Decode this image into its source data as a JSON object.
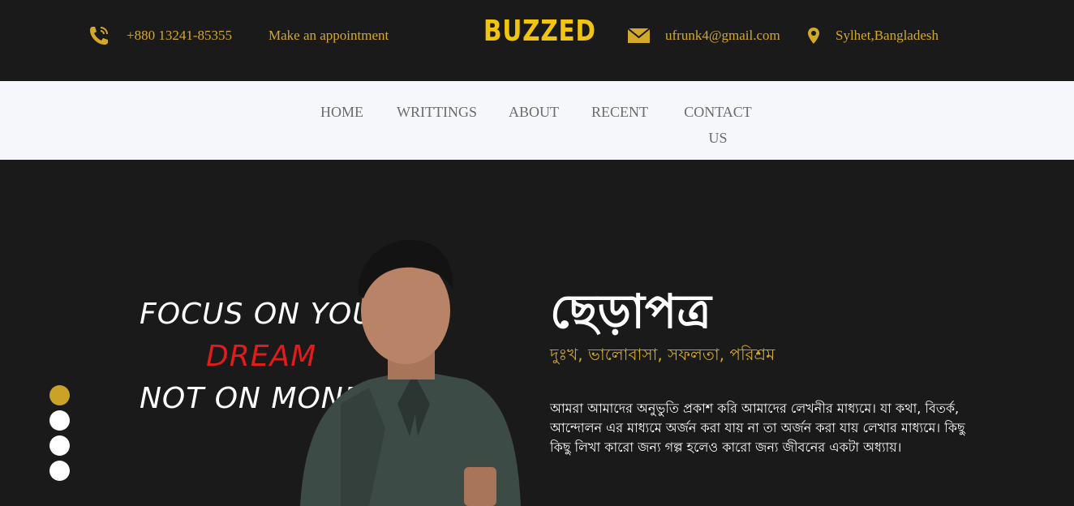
{
  "header": {
    "phone_icon": "phone-icon",
    "phone": "+880 13241-85355",
    "appointment": "Make an appointment",
    "brand": "BUZZED",
    "mail_icon": "mail-icon",
    "email": "ufrunk4@gmail.com",
    "location_icon": "location-pin-icon",
    "location": "Sylhet,Bangladesh"
  },
  "nav": {
    "items": [
      {
        "label": "HOME"
      },
      {
        "label": "WRITTINGS"
      },
      {
        "label": "ABOUT"
      },
      {
        "label": "RECENT"
      },
      {
        "label": "CONTACT US"
      }
    ]
  },
  "hero": {
    "quote": {
      "line1": "FOCUS ON YOUR",
      "line2": "DREAM",
      "line3": "NOT ON MONEY"
    },
    "title": "ছেড়াপত্র",
    "subtitle": "দুঃখ, ভালোবাসা, সফলতা, পরিশ্রম",
    "paragraph": "আমরা আমাদের অনুভুতি প্রকাশ করি আমাদের লেখনীর মাধ্যমে। যা কথা, বিতর্ক, আন্দোলন এর মাধ্যমে অর্জন করা যায় না তা অর্জন করা যায় লেখার মাধ্যমে। কিছু কিছু লিখা কারো জন্য গল্প হলেও কারো জন্য জীবনের একটা অধ্যায়।",
    "slider": {
      "count": 4,
      "active_index": 1
    }
  },
  "colors": {
    "background": "#1a1a1a",
    "accent": "#d4a82a",
    "brand": "#f1c40f",
    "nav_bg": "#f5f7fa",
    "quote_red": "#e21b1b"
  }
}
